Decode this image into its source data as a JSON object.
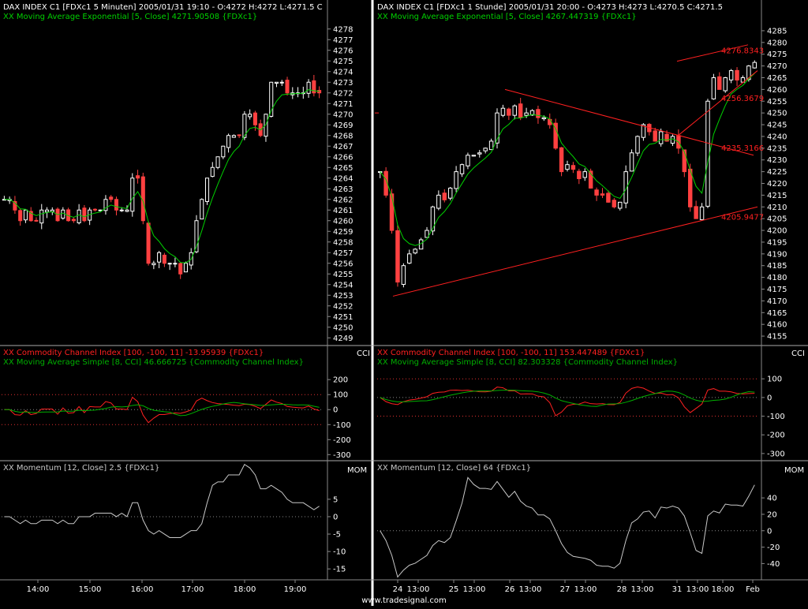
{
  "colors": {
    "bg": "#000000",
    "candle_up": "#ffffff",
    "candle_down": "#ff4040",
    "ema": "#00d000",
    "cci": "#ff2020",
    "cci_ma": "#00b000",
    "momentum": "#c8c8c8",
    "trend": "#ff2020",
    "level": "#e03030",
    "text": "#ffffff",
    "divider": "#ffffff"
  },
  "left": {
    "price_title": "DAX INDEX C1 [FDXc1  5 Minuten] 2005/01/31 19:10 - O:4272 H:4272 L:4271.5 C",
    "ema_label": "XX Moving Average Exponential [5, Close] 4271.90508 {FDXc1}",
    "cci_title": "XX Commodity Channel Index [100, -100, 11] -13.95939 {FDXc1}",
    "cci_ma_label": "XX Moving Average Simple [8, CCI] 46.666725 {Commodity Channel Index}",
    "cci_axis_label": "CCI",
    "mom_title": "XX Momentum [12, Close] 2.5 {FDXc1}",
    "mom_axis_label": "MOM",
    "x_ticks": [
      "14:00",
      "15:00",
      "16:00",
      "17:00",
      "18:00",
      "19:00"
    ],
    "price_ticks": [
      "4278",
      "4277",
      "4276",
      "4275",
      "4274",
      "4273",
      "4272",
      "4271",
      "4270",
      "4269",
      "4268",
      "4267",
      "4266",
      "4265",
      "4264",
      "4263",
      "4262",
      "4261",
      "4260",
      "4259",
      "4258",
      "4257",
      "4256",
      "4255",
      "4254",
      "4253",
      "4252",
      "4251",
      "4250",
      "4249"
    ],
    "cci_ticks": [
      "200",
      "100",
      "0",
      "-100",
      "-200",
      "-300"
    ],
    "mom_ticks": [
      "5",
      "0",
      "-5",
      "-10",
      "-15"
    ]
  },
  "right": {
    "price_title": "DAX INDEX C1 [FDXc1  1 Stunde] 2005/01/31 20:00 - O:4273 H:4273 L:4270.5 C:4271.5",
    "ema_label": "XX Moving Average Exponential [5, Close] 4267.447319 {FDXc1}",
    "cci_title": "XX Commodity Channel Index [100, -100, 11] 153.447489 {FDXc1}",
    "cci_ma_label": "XX Moving Average Simple [8, CCI] 82.303328 {Commodity Channel Index}",
    "cci_axis_label": "CCI",
    "mom_title": "XX Momentum [12, Close] 64 {FDXc1}",
    "mom_axis_label": "MOM",
    "x_ticks": [
      "24",
      "13:00",
      "25",
      "13:00",
      "26",
      "13:00",
      "27",
      "13:00",
      "28",
      "13:00",
      "31",
      "13:00",
      "18:00",
      "Feb"
    ],
    "price_ticks": [
      "4285",
      "4280",
      "4275",
      "4270",
      "4265",
      "4260",
      "4255",
      "4250",
      "4245",
      "4240",
      "4235",
      "4230",
      "4225",
      "4220",
      "4215",
      "4210",
      "4205",
      "4200",
      "4195",
      "4190",
      "4185",
      "4180",
      "4175",
      "4170",
      "4165",
      "4160",
      "4155"
    ],
    "cci_ticks": [
      "100",
      "0",
      "-100",
      "-200",
      "-300"
    ],
    "mom_ticks": [
      "40",
      "20",
      "0",
      "-20",
      "-40"
    ],
    "trend_labels": [
      "4276.8343",
      "4256.3679",
      "4235.3166",
      "4205.9477"
    ]
  },
  "footer": "www.tradesignal.com",
  "chart_data": [
    {
      "type": "candlestick",
      "title": "DAX INDEX C1 [FDXc1  5 Minuten]",
      "timeframe": "5 Minuten",
      "ylim": [
        4248.5,
        4278.5
      ],
      "close": [
        4262,
        4262,
        4261,
        4260,
        4261,
        4260,
        4260,
        4261,
        4261,
        4261,
        4260,
        4261,
        4260,
        4260,
        4261,
        4260,
        4261,
        4261,
        4261,
        4262,
        4262,
        4261,
        4261,
        4261,
        4264,
        4264,
        4260,
        4256,
        4256,
        4257,
        4256,
        4256,
        4256,
        4255,
        4256,
        4257,
        4260,
        4262,
        4264,
        4265,
        4266,
        4267,
        4268,
        4268,
        4268,
        4270,
        4270,
        4269,
        4268,
        4270,
        4273,
        4273,
        4273,
        4272,
        4272,
        4272,
        4272,
        4273,
        4272,
        4272
      ],
      "ema_last": 4271.90508
    },
    {
      "type": "line",
      "title": "XX Commodity Channel Index [100, -100, 11]",
      "series": [
        {
          "name": "CCI",
          "last": -13.95939
        },
        {
          "name": "MA [8, CCI]",
          "last": 46.666725
        }
      ],
      "ylim": [
        -330,
        280
      ]
    },
    {
      "type": "line",
      "title": "XX Momentum [12, Close]",
      "series": [
        {
          "name": "Momentum",
          "last": 2.5
        }
      ],
      "ylim": [
        -17,
        12
      ]
    },
    {
      "type": "candlestick",
      "title": "DAX INDEX C1 [FDXc1  1 Stunde]",
      "timeframe": "1 Stunde",
      "ylim": [
        4152,
        4288
      ],
      "close": [
        4225,
        4215,
        4200,
        4178,
        4185,
        4190,
        4192,
        4196,
        4200,
        4210,
        4215,
        4213,
        4218,
        4225,
        4228,
        4232,
        4232,
        4233,
        4235,
        4238,
        4250,
        4252,
        4249,
        4253,
        4248,
        4250,
        4251,
        4248,
        4248,
        4245,
        4235,
        4225,
        4228,
        4226,
        4222,
        4225,
        4218,
        4215,
        4215,
        4212,
        4210,
        4212,
        4225,
        4233,
        4240,
        4245,
        4242,
        4238,
        4242,
        4238,
        4240,
        4235,
        4225,
        4210,
        4205,
        4210,
        4255,
        4265,
        4260,
        4265,
        4268,
        4264,
        4265,
        4270,
        4271.5
      ],
      "ema_last": 4267.447319,
      "trendlines": [
        {
          "label": "4276.8343",
          "value": 4276.8343
        },
        {
          "label": "4256.3679",
          "value": 4256.3679
        },
        {
          "label": "4235.3166",
          "value": 4235.3166
        },
        {
          "label": "4205.9477",
          "value": 4205.9477
        }
      ]
    },
    {
      "type": "line",
      "title": "XX Commodity Channel Index [100, -100, 11]",
      "series": [
        {
          "name": "CCI",
          "last": 153.447489
        },
        {
          "name": "MA [8, CCI]",
          "last": 82.303328
        }
      ],
      "ylim": [
        -330,
        160
      ]
    },
    {
      "type": "line",
      "title": "XX Momentum [12, Close]",
      "series": [
        {
          "name": "Momentum",
          "last": 64
        }
      ],
      "ylim": [
        -55,
        68
      ]
    }
  ]
}
